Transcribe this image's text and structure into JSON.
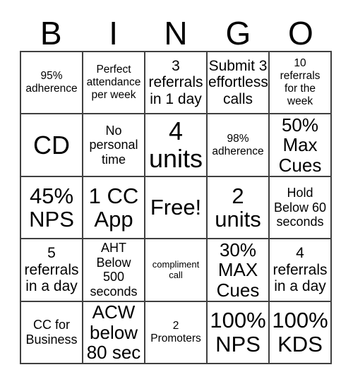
{
  "card": {
    "title": "BINGO",
    "header_letters": [
      "B",
      "I",
      "N",
      "G",
      "O"
    ],
    "free_space_label": "Free!",
    "colors": {
      "border": "#404040",
      "cell_background": "#ffffff",
      "text": "#000000",
      "page_background": "#ffffff"
    },
    "grid_size": "5x5",
    "rows": [
      [
        {
          "text": "95%\nadherence",
          "size": "sm",
          "free": false
        },
        {
          "text": "Perfect\nattendance\nper week",
          "size": "sm",
          "free": false
        },
        {
          "text": "3\nreferrals\nin 1 day",
          "size": "lg",
          "free": false
        },
        {
          "text": "Submit 3\neffortless\ncalls",
          "size": "lg",
          "free": false
        },
        {
          "text": "10\nreferrals\nfor the\nweek",
          "size": "sm",
          "free": false
        }
      ],
      [
        {
          "text": "CD",
          "size": "huge",
          "free": false
        },
        {
          "text": "No\npersonal\ntime",
          "size": "md",
          "free": false
        },
        {
          "text": "4\nunits",
          "size": "huge",
          "free": false
        },
        {
          "text": "98%\nadherence",
          "size": "sm",
          "free": false
        },
        {
          "text": "50%\nMax\nCues",
          "size": "xl",
          "free": false
        }
      ],
      [
        {
          "text": "45%\nNPS",
          "size": "xxl",
          "free": false
        },
        {
          "text": "1 CC\nApp",
          "size": "xxl",
          "free": false
        },
        {
          "text": "Free!",
          "size": "xxl",
          "free": true
        },
        {
          "text": "2\nunits",
          "size": "xxl",
          "free": false
        },
        {
          "text": "Hold\nBelow 60\nseconds",
          "size": "md",
          "free": false
        }
      ],
      [
        {
          "text": "5\nreferrals\nin a day",
          "size": "lg",
          "free": false
        },
        {
          "text": "AHT\nBelow 500\nseconds",
          "size": "md",
          "free": false
        },
        {
          "text": "compliment\ncall",
          "size": "xs",
          "free": false
        },
        {
          "text": "30%\nMAX\nCues",
          "size": "xl",
          "free": false
        },
        {
          "text": "4\nreferrals\nin a day",
          "size": "lg",
          "free": false
        }
      ],
      [
        {
          "text": "CC for\nBusiness",
          "size": "md",
          "free": false
        },
        {
          "text": "ACW\nbelow\n80 sec",
          "size": "xl",
          "free": false
        },
        {
          "text": "2\nPromoters",
          "size": "sm",
          "free": false
        },
        {
          "text": "100%\nNPS",
          "size": "xxl",
          "free": false
        },
        {
          "text": "100%\nKDS",
          "size": "xxl",
          "free": false
        }
      ]
    ]
  }
}
